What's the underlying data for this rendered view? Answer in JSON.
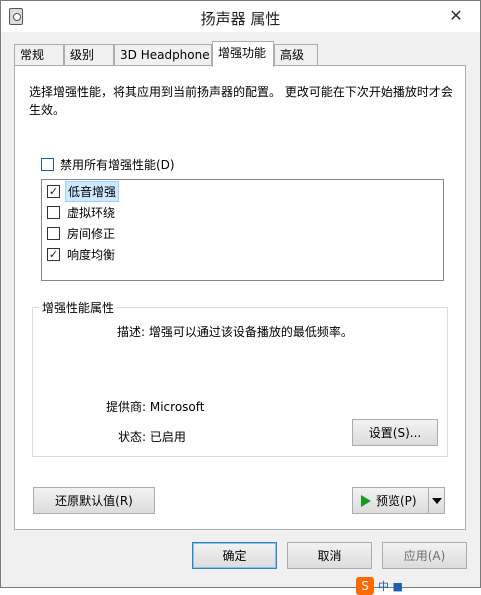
{
  "window": {
    "title": "扬声器 属性",
    "close_label": "✕"
  },
  "tabs": [
    {
      "label": "常规"
    },
    {
      "label": "级别"
    },
    {
      "label": "3D Headphone"
    },
    {
      "label": "增强功能",
      "active": true
    },
    {
      "label": "高级"
    }
  ],
  "description": "选择增强性能，将其应用到当前扬声器的配置。 更改可能在下次开始播放时才会生效。",
  "disable_all": {
    "label": "禁用所有增强性能(D)",
    "checked": false
  },
  "enhancements": [
    {
      "label": "低音增强",
      "checked": true,
      "selected": true
    },
    {
      "label": "虚拟环绕",
      "checked": false
    },
    {
      "label": "房间修正",
      "checked": false
    },
    {
      "label": "响度均衡",
      "checked": true
    }
  ],
  "properties": {
    "group_title": "增强性能属性",
    "description": "描述: 增强可以通过该设备播放的最低频率。",
    "provider": "提供商: Microsoft",
    "status": "状态: 已启用",
    "settings_button": "设置(S)..."
  },
  "buttons": {
    "restore_defaults": "还原默认值(R)",
    "preview": "预览(P)",
    "ok": "确定",
    "cancel": "取消",
    "apply": "应用(A)"
  },
  "watermark": {
    "logo": "S",
    "text": "中 ■"
  },
  "colors": {
    "accent": "#3c7fb1",
    "selection": "#cde8ff",
    "play": "#1a9a1a"
  }
}
